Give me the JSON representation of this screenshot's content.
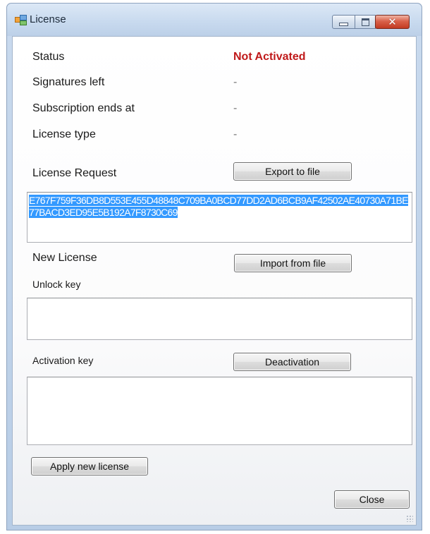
{
  "window": {
    "title": "License",
    "icon": "license-app-icon",
    "controls": {
      "minimize": "minimize-icon",
      "maximize": "maximize-icon",
      "close": "close-icon",
      "close_glyph": "✕"
    }
  },
  "info": {
    "status_label": "Status",
    "status_value": "Not Activated",
    "signatures_label": "Signatures left",
    "signatures_value": "-",
    "subscription_label": "Subscription ends at",
    "subscription_value": "-",
    "license_type_label": "License type",
    "license_type_value": "-"
  },
  "request": {
    "label": "License Request",
    "export_button": "Export to file",
    "text": "E767F759F36DB8D553E455D48848C709BA0BCD77DD2AD6BCB9AF42502AE40730A71BE77BACD3ED95E5B192A7F8730C69"
  },
  "new_license": {
    "label": "New License",
    "import_button": "Import from file",
    "unlock_key_label": "Unlock key",
    "unlock_key_value": "",
    "activation_key_label": "Activation key",
    "deactivation_button": "Deactivation",
    "activation_key_value": ""
  },
  "actions": {
    "apply_button": "Apply new license",
    "close_button": "Close"
  },
  "colors": {
    "status_not_activated": "#c0191a",
    "selection_highlight": "#3399ff"
  }
}
